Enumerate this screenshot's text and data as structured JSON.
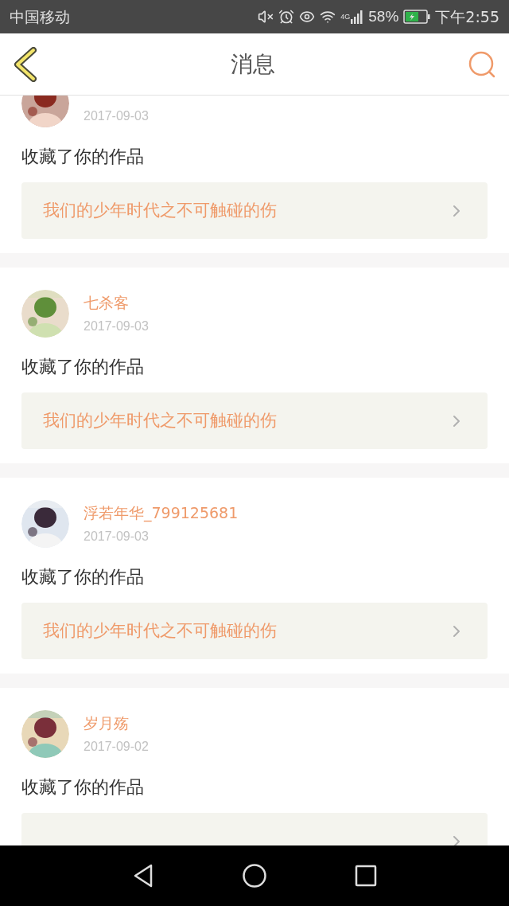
{
  "status_bar": {
    "carrier": "中国移动",
    "network": "4G",
    "battery": "58%",
    "time": "下午2:55"
  },
  "header": {
    "title": "消息"
  },
  "messages": [
    {
      "date": "2017-09-03",
      "action": "收藏了你的作品",
      "work": "我们的少年时代之不可触碰的伤"
    },
    {
      "name": "七杀客",
      "date": "2017-09-03",
      "action": "收藏了你的作品",
      "work": "我们的少年时代之不可触碰的伤"
    },
    {
      "name": "浮若年华_799125681",
      "date": "2017-09-03",
      "action": "收藏了你的作品",
      "work": "我们的少年时代之不可触碰的伤"
    },
    {
      "name": "岁月殇",
      "date": "2017-09-02",
      "action": "收藏了你的作品"
    }
  ]
}
